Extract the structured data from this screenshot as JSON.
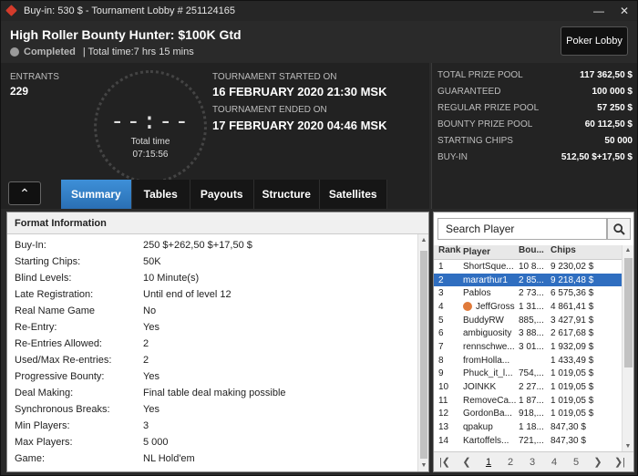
{
  "window": {
    "title": "Buy-in: 530 $ - Tournament Lobby # 251124165"
  },
  "header": {
    "name": "High Roller Bounty Hunter: $100K Gtd",
    "status": "Completed",
    "total_time": "| Total time:7 hrs  15 mins",
    "lobby_button": "Poker Lobby"
  },
  "info": {
    "entrants_label": "ENTRANTS",
    "entrants": "229",
    "clock": "--:--",
    "total_time_label": "Total time",
    "total_time_value": "07:15:56",
    "started_label": "TOURNAMENT STARTED ON",
    "started": "16 FEBRUARY 2020  21:30 MSK",
    "ended_label": "TOURNAMENT ENDED ON",
    "ended": "17 FEBRUARY 2020  04:46 MSK"
  },
  "prize": [
    {
      "label": "TOTAL PRIZE POOL",
      "value": "117 362,50 $"
    },
    {
      "label": "GUARANTEED",
      "value": "100 000 $"
    },
    {
      "label": "REGULAR PRIZE POOL",
      "value": "57 250 $"
    },
    {
      "label": "BOUNTY PRIZE POOL",
      "value": "60 112,50 $"
    },
    {
      "label": "STARTING CHIPS",
      "value": "50 000"
    },
    {
      "label": "BUY-IN",
      "value": "512,50 $+17,50 $"
    }
  ],
  "tabs": [
    "Summary",
    "Tables",
    "Payouts",
    "Structure",
    "Satellites"
  ],
  "format": {
    "title": "Format Information",
    "rows": [
      {
        "k": "Buy-In:",
        "v": "250 $+262,50 $+17,50 $"
      },
      {
        "k": "Starting Chips:",
        "v": "50K"
      },
      {
        "k": "Blind Levels:",
        "v": "10 Minute(s)"
      },
      {
        "k": "Late Registration:",
        "v": "Until end of level 12"
      },
      {
        "k": "Real Name Game",
        "v": "No"
      },
      {
        "k": "Re-Entry:",
        "v": "Yes"
      },
      {
        "k": "Re-Entries Allowed:",
        "v": "2"
      },
      {
        "k": "Used/Max Re-entries:",
        "v": "2"
      },
      {
        "k": "Progressive Bounty:",
        "v": "Yes"
      },
      {
        "k": "Deal Making:",
        "v": "Final table deal making possible"
      },
      {
        "k": "Synchronous Breaks:",
        "v": "Yes"
      },
      {
        "k": "Min Players:",
        "v": "3"
      },
      {
        "k": "Max Players:",
        "v": "5 000"
      },
      {
        "k": "Game:",
        "v": "NL Hold'em"
      }
    ]
  },
  "players": {
    "search_placeholder": "Search Player",
    "headers": [
      "Rank",
      "Player",
      "Bou...",
      "Chips"
    ],
    "rows": [
      {
        "rank": "1",
        "name": "ShortSque...",
        "bounty": "10 8...",
        "chips": "9 230,02 $"
      },
      {
        "rank": "2",
        "name": "mararthur1",
        "bounty": "2 85...",
        "chips": "9 218,48 $"
      },
      {
        "rank": "3",
        "name": "Pablos",
        "bounty": "2 73...",
        "chips": "6 575,36 $"
      },
      {
        "rank": "4",
        "name": "JeffGross",
        "bounty": "1 31...",
        "chips": "4 861,41 $"
      },
      {
        "rank": "5",
        "name": "BuddyRW",
        "bounty": "885,...",
        "chips": "3 427,91 $"
      },
      {
        "rank": "6",
        "name": "ambiguosity",
        "bounty": "3 88...",
        "chips": "2 617,68 $"
      },
      {
        "rank": "7",
        "name": "rennschwe...",
        "bounty": "3 01...",
        "chips": "1 932,09 $"
      },
      {
        "rank": "8",
        "name": "fromHolla...",
        "bounty": "",
        "chips": "1 433,49 $"
      },
      {
        "rank": "9",
        "name": "Phuck_it_l...",
        "bounty": "754,...",
        "chips": "1 019,05 $"
      },
      {
        "rank": "10",
        "name": "JOINKK",
        "bounty": "2 27...",
        "chips": "1 019,05 $"
      },
      {
        "rank": "11",
        "name": "RemoveCa...",
        "bounty": "1 87...",
        "chips": "1 019,05 $"
      },
      {
        "rank": "12",
        "name": "GordonBa...",
        "bounty": "918,...",
        "chips": "1 019,05 $"
      },
      {
        "rank": "13",
        "name": "qpakup",
        "bounty": "1 18...",
        "chips": "847,30 $"
      },
      {
        "rank": "14",
        "name": "Kartoffels...",
        "bounty": "721,...",
        "chips": "847,30 $"
      }
    ],
    "pages": [
      "1",
      "2",
      "3",
      "4",
      "5"
    ]
  },
  "colors": {
    "accent": "#2f6ec0",
    "bounty_badge": "#e07a3a"
  }
}
